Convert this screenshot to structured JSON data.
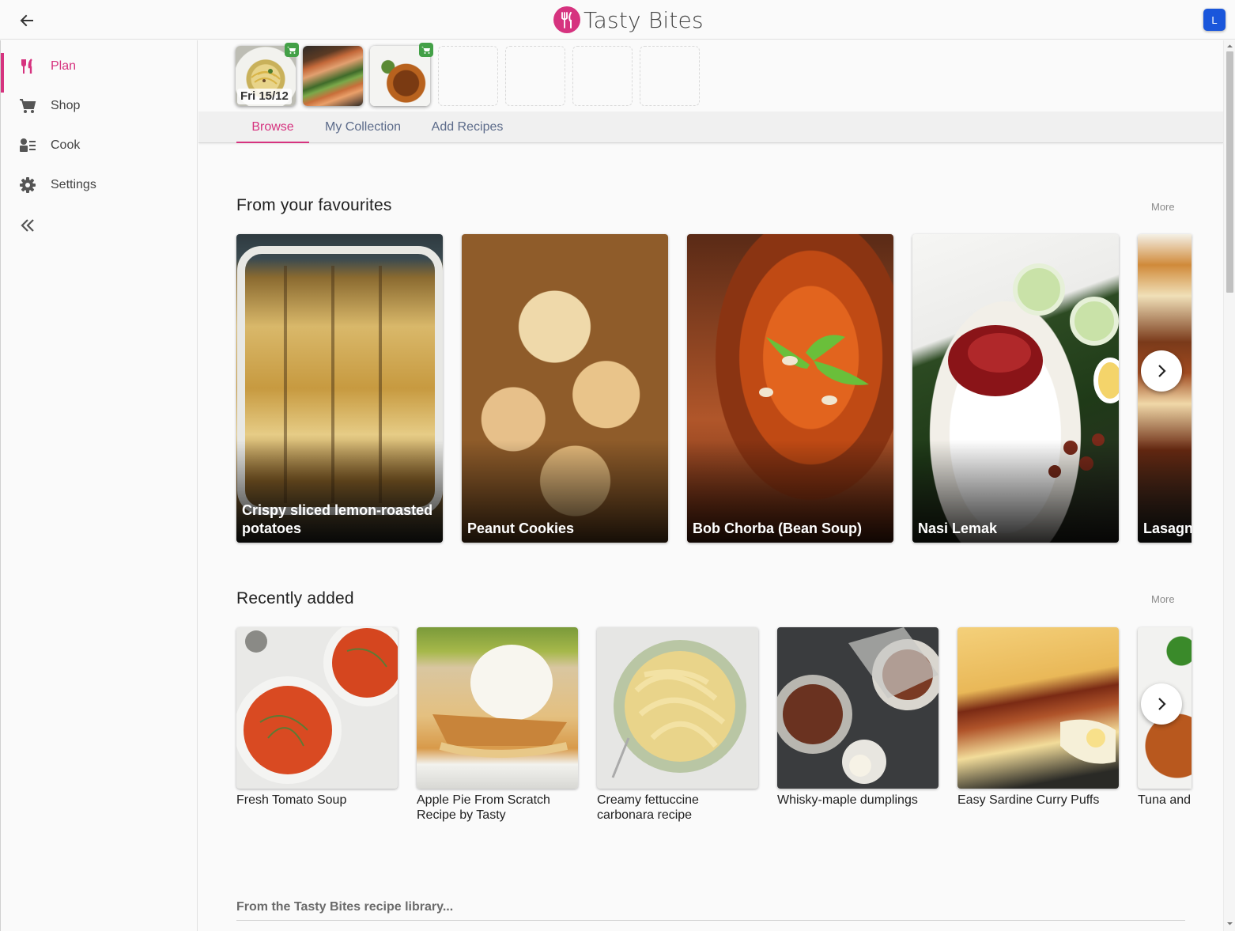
{
  "app": {
    "brand": "Tasty Bites",
    "avatar_initial": "L",
    "accent": "#d6337f"
  },
  "sidebar": {
    "items": [
      {
        "label": "Plan",
        "icon": "cutlery-icon",
        "active": true
      },
      {
        "label": "Shop",
        "icon": "cart-icon",
        "active": false
      },
      {
        "label": "Cook",
        "icon": "cook-icon",
        "active": false
      },
      {
        "label": "Settings",
        "icon": "gear-icon",
        "active": false
      }
    ],
    "collapse_icon": "double-chevron-left-icon"
  },
  "planner": {
    "date_label": "Fri 15/12",
    "slots": [
      {
        "filled": true,
        "in_cart": true,
        "dish": "pasta"
      },
      {
        "filled": true,
        "in_cart": false,
        "dish": "salmon"
      },
      {
        "filled": true,
        "in_cart": true,
        "dish": "croquettes"
      },
      {
        "filled": false
      },
      {
        "filled": false
      },
      {
        "filled": false
      },
      {
        "filled": false
      }
    ]
  },
  "tabs": [
    {
      "label": "Browse",
      "active": true
    },
    {
      "label": "My Collection",
      "active": false
    },
    {
      "label": "Add Recipes",
      "active": false
    }
  ],
  "favourites": {
    "title": "From your favourites",
    "more_label": "More",
    "items": [
      {
        "title": "Crispy sliced lemon-roasted potatoes"
      },
      {
        "title": "Peanut Cookies"
      },
      {
        "title": "Bob Chorba (Bean Soup)"
      },
      {
        "title": "Nasi Lemak"
      },
      {
        "title": "Lasagn"
      }
    ]
  },
  "recent": {
    "title": "Recently added",
    "more_label": "More",
    "items": [
      {
        "title": "Fresh Tomato Soup"
      },
      {
        "title": "Apple Pie From Scratch Recipe by Tasty"
      },
      {
        "title": "Creamy fettuccine carbonara recipe"
      },
      {
        "title": "Whisky-maple dumplings"
      },
      {
        "title": "Easy Sardine Curry Puffs"
      },
      {
        "title": "Tuna and"
      }
    ]
  },
  "library": {
    "label": "From the Tasty Bites recipe library..."
  }
}
